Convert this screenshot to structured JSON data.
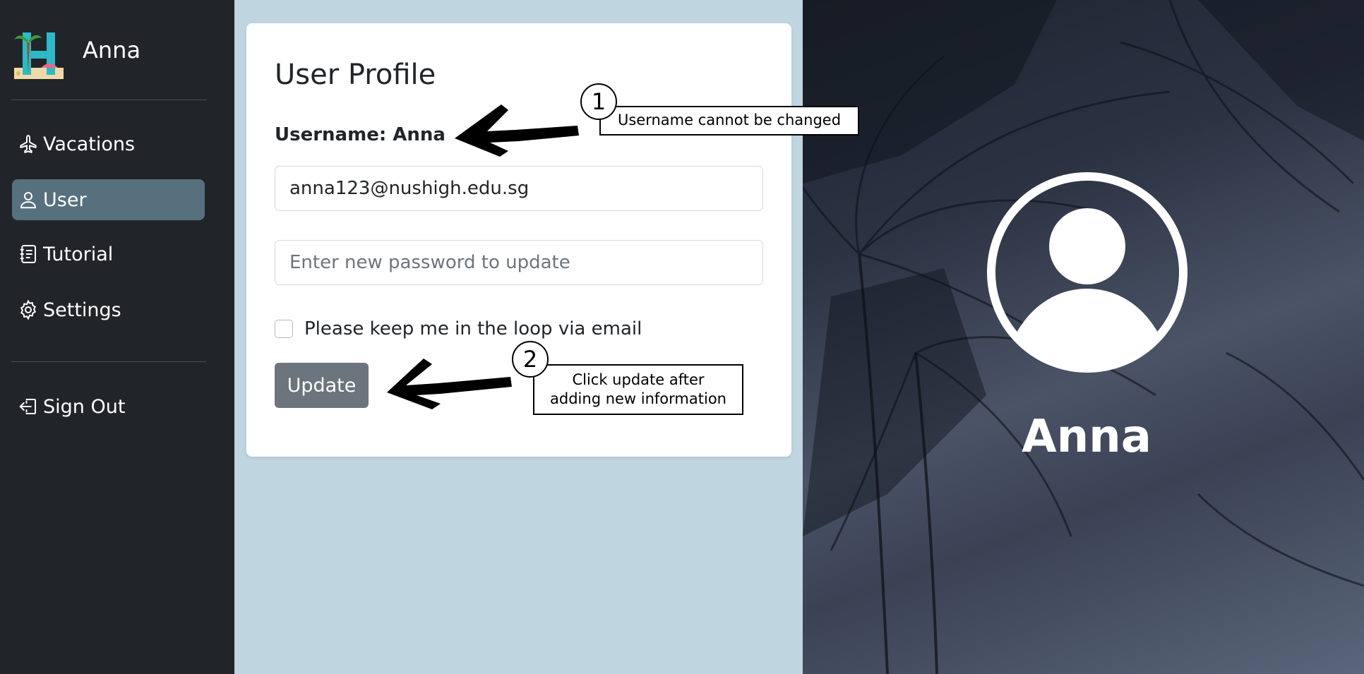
{
  "sidebar": {
    "brand_name": "Anna",
    "items": [
      {
        "label": "Vacations",
        "icon": "airplane-icon"
      },
      {
        "label": "User",
        "icon": "person-icon"
      },
      {
        "label": "Tutorial",
        "icon": "journal-icon"
      },
      {
        "label": "Settings",
        "icon": "gear-icon"
      }
    ],
    "sign_out": {
      "label": "Sign Out",
      "icon": "box-arrow-left-icon"
    }
  },
  "profile": {
    "title": "User Profile",
    "username_label": "Username: Anna",
    "email_value": "anna123@nushigh.edu.sg",
    "password_placeholder": "Enter new password to update",
    "newsletter_label": "Please keep me in the loop via email",
    "update_label": "Update"
  },
  "hero": {
    "name": "Anna",
    "icon": "person-circle-icon"
  },
  "annotations": [
    {
      "number": "1",
      "text": "Username cannot be changed"
    },
    {
      "number": "2",
      "text_line1": "Click update after",
      "text_line2": "adding new information"
    }
  ],
  "colors": {
    "sidebar_bg": "#212529",
    "active_item": "#56707e",
    "page_bg": "#bfd5df",
    "button_bg": "#6c757d"
  }
}
